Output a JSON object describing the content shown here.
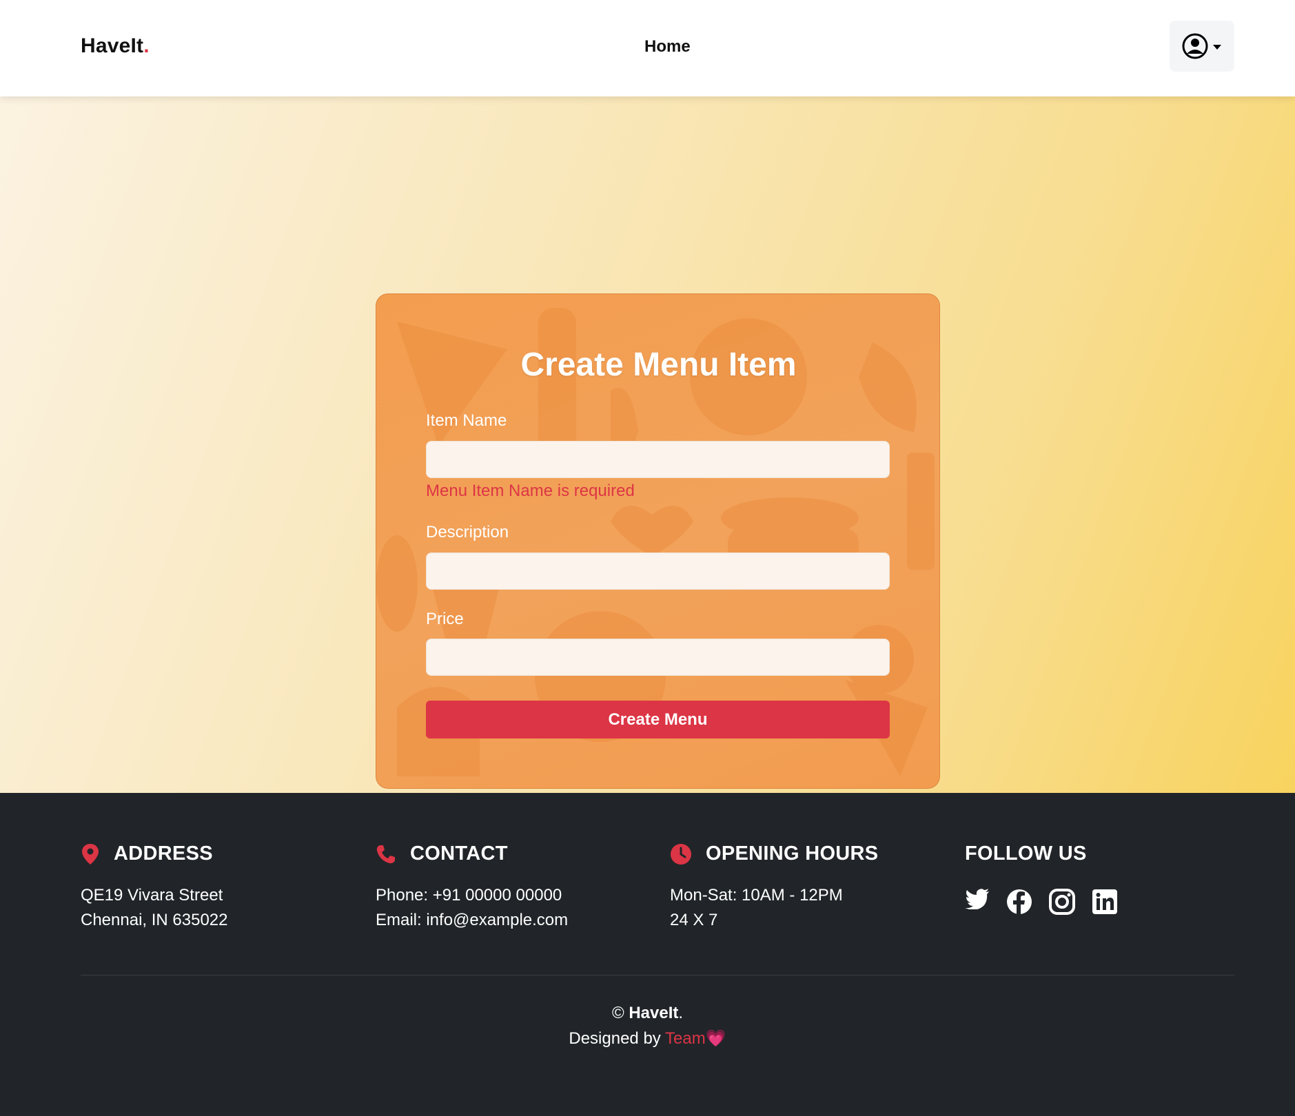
{
  "header": {
    "brand": "HaveIt",
    "brand_dot": ".",
    "nav_home": "Home"
  },
  "form": {
    "title": "Create Menu Item",
    "item_name_label": "Item Name",
    "item_name_value": "",
    "item_name_error": "Menu Item Name is required",
    "description_label": "Description",
    "description_value": "",
    "price_label": "Price",
    "price_value": "",
    "submit_label": "Create Menu"
  },
  "footer": {
    "address": {
      "title": "ADDRESS",
      "line1": "QE19 Vivara Street",
      "line2": "Chennai, IN 635022"
    },
    "contact": {
      "title": "CONTACT",
      "line1": "Phone: +91 00000 00000",
      "line2": "Email: info@example.com"
    },
    "hours": {
      "title": "OPENING HOURS",
      "line1": "Mon-Sat: 10AM - 12PM",
      "line2": "24 X 7"
    },
    "follow": {
      "title": "FOLLOW US",
      "icons": [
        "twitter-icon",
        "facebook-icon",
        "instagram-icon",
        "linkedin-icon"
      ]
    },
    "copyright_symbol": "©",
    "copyright_brand": "HaveIt",
    "copyright_dot": ".",
    "designed_by": "Designed by",
    "team": "Team",
    "heart": "💗"
  },
  "colors": {
    "accent": "#dc3545",
    "footer_bg": "#212529",
    "card_orange": "#f29d52"
  }
}
